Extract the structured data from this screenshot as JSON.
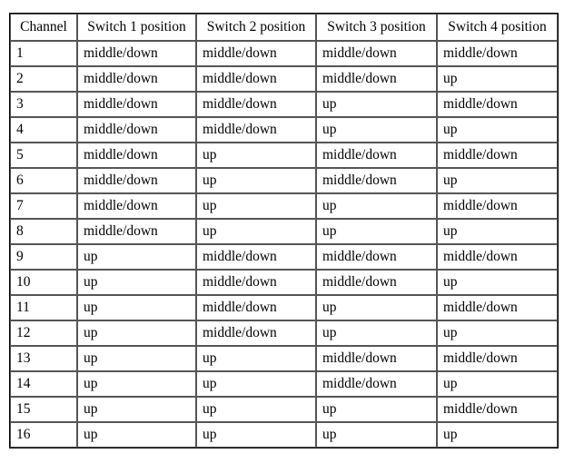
{
  "table": {
    "headers": [
      "Channel",
      "Switch 1 position",
      "Switch 2 position",
      "Switch 3 position",
      "Switch 4 position"
    ],
    "rows": [
      [
        "1",
        "middle/down",
        "middle/down",
        "middle/down",
        "middle/down"
      ],
      [
        "2",
        "middle/down",
        "middle/down",
        "middle/down",
        "up"
      ],
      [
        "3",
        "middle/down",
        "middle/down",
        "up",
        "middle/down"
      ],
      [
        "4",
        "middle/down",
        "middle/down",
        "up",
        "up"
      ],
      [
        "5",
        "middle/down",
        "up",
        "middle/down",
        "middle/down"
      ],
      [
        "6",
        "middle/down",
        "up",
        "middle/down",
        "up"
      ],
      [
        "7",
        "middle/down",
        "up",
        "up",
        "middle/down"
      ],
      [
        "8",
        "middle/down",
        "up",
        "up",
        "up"
      ],
      [
        "9",
        "up",
        "middle/down",
        "middle/down",
        "middle/down"
      ],
      [
        "10",
        "up",
        "middle/down",
        "middle/down",
        "up"
      ],
      [
        "11",
        "up",
        "middle/down",
        "up",
        "middle/down"
      ],
      [
        "12",
        "up",
        "middle/down",
        "up",
        "up"
      ],
      [
        "13",
        "up",
        "up",
        "middle/down",
        "middle/down"
      ],
      [
        "14",
        "up",
        "up",
        "middle/down",
        "up"
      ],
      [
        "15",
        "up",
        "up",
        "up",
        "middle/down"
      ],
      [
        "16",
        "up",
        "up",
        "up",
        "up"
      ]
    ]
  },
  "colors": {
    "page_background": "#ffffff",
    "text": "#000000",
    "cell_border": "#555555",
    "table_border": "#000000"
  }
}
